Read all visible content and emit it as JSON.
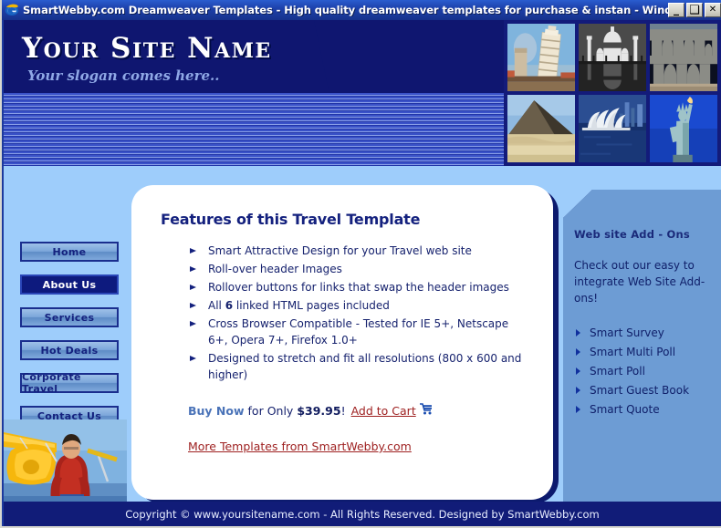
{
  "window": {
    "title": "SmartWebby.com Dreamweaver Templates - High quality dreamweaver templates for purchase & instan - Windows Interne...",
    "app_icon": "internet-explorer-icon",
    "minimize_label": "_",
    "maximize_label": "❑",
    "close_label": "✕"
  },
  "banner": {
    "site_name": "Your Site Name",
    "slogan": "Your slogan comes here..",
    "photos": [
      {
        "name": "leaning-tower-of-pisa-photo",
        "alt": "Leaning Tower of Pisa"
      },
      {
        "name": "taj-mahal-photo",
        "alt": "Taj Mahal"
      },
      {
        "name": "roman-aqueduct-photo",
        "alt": "Roman Aqueduct"
      },
      {
        "name": "pyramid-photo",
        "alt": "Egyptian Pyramid"
      },
      {
        "name": "sydney-opera-house-photo",
        "alt": "Sydney Opera House"
      },
      {
        "name": "statue-of-liberty-photo",
        "alt": "Statue of Liberty"
      }
    ]
  },
  "nav": {
    "items": [
      {
        "label": "Home",
        "active": false
      },
      {
        "label": "About Us",
        "active": true
      },
      {
        "label": "Services",
        "active": false
      },
      {
        "label": "Hot Deals",
        "active": false
      },
      {
        "label": "Corporate Travel",
        "active": false
      },
      {
        "label": "Contact Us",
        "active": false
      }
    ]
  },
  "content": {
    "title": "Features of this Travel Template",
    "features": [
      {
        "text": "Smart Attractive Design for your Travel web site"
      },
      {
        "text": "Roll-over header Images"
      },
      {
        "text": "Rollover buttons for links that swap the header images"
      },
      {
        "pre": "All ",
        "bold": "6",
        "post": " linked HTML pages included"
      },
      {
        "text": "Cross Browser Compatible - Tested for IE 5+, Netscape 6+, Opera 7+, Firefox 1.0+"
      },
      {
        "text": "Designed to stretch and fit all resolutions (800 x 600 and higher)"
      }
    ],
    "buy": {
      "buy_now": "Buy Now",
      "for_only": "for Only",
      "price": "$39.95",
      "exclamation": "!",
      "add_to_cart": "Add to Cart",
      "cart_icon": "shopping-cart-icon"
    },
    "more_templates": "More Templates from SmartWebby.com"
  },
  "rail": {
    "title": "Web site Add - Ons",
    "description": "Check out our easy to integrate Web Site Add-ons!",
    "links": [
      {
        "label": "Smart Survey"
      },
      {
        "label": "Smart Multi Poll"
      },
      {
        "label": "Smart Poll"
      },
      {
        "label": "Smart Guest Book"
      },
      {
        "label": "Smart Quote"
      }
    ]
  },
  "photos": {
    "pilot": {
      "name": "pilot-and-airplane-photo",
      "alt": "Man seated in front of a yellow vintage airplane"
    }
  },
  "footer": {
    "text": "Copyright © www.yoursitename.com - All Rights Reserved. Designed by SmartWebby.com"
  },
  "colors": {
    "navy": "#0f1670",
    "page_blue": "#9ecdfb",
    "rail_blue": "#6d9cd4",
    "link_red": "#9e2020",
    "accent_blue": "#4a73b8"
  }
}
